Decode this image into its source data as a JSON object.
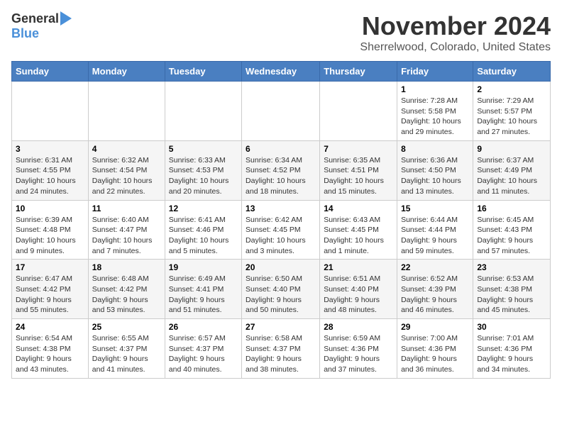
{
  "logo": {
    "general": "General",
    "blue": "Blue"
  },
  "title": "November 2024",
  "location": "Sherrelwood, Colorado, United States",
  "days_of_week": [
    "Sunday",
    "Monday",
    "Tuesday",
    "Wednesday",
    "Thursday",
    "Friday",
    "Saturday"
  ],
  "weeks": [
    [
      {
        "day": "",
        "info": ""
      },
      {
        "day": "",
        "info": ""
      },
      {
        "day": "",
        "info": ""
      },
      {
        "day": "",
        "info": ""
      },
      {
        "day": "",
        "info": ""
      },
      {
        "day": "1",
        "info": "Sunrise: 7:28 AM\nSunset: 5:58 PM\nDaylight: 10 hours and 29 minutes."
      },
      {
        "day": "2",
        "info": "Sunrise: 7:29 AM\nSunset: 5:57 PM\nDaylight: 10 hours and 27 minutes."
      }
    ],
    [
      {
        "day": "3",
        "info": "Sunrise: 6:31 AM\nSunset: 4:55 PM\nDaylight: 10 hours and 24 minutes."
      },
      {
        "day": "4",
        "info": "Sunrise: 6:32 AM\nSunset: 4:54 PM\nDaylight: 10 hours and 22 minutes."
      },
      {
        "day": "5",
        "info": "Sunrise: 6:33 AM\nSunset: 4:53 PM\nDaylight: 10 hours and 20 minutes."
      },
      {
        "day": "6",
        "info": "Sunrise: 6:34 AM\nSunset: 4:52 PM\nDaylight: 10 hours and 18 minutes."
      },
      {
        "day": "7",
        "info": "Sunrise: 6:35 AM\nSunset: 4:51 PM\nDaylight: 10 hours and 15 minutes."
      },
      {
        "day": "8",
        "info": "Sunrise: 6:36 AM\nSunset: 4:50 PM\nDaylight: 10 hours and 13 minutes."
      },
      {
        "day": "9",
        "info": "Sunrise: 6:37 AM\nSunset: 4:49 PM\nDaylight: 10 hours and 11 minutes."
      }
    ],
    [
      {
        "day": "10",
        "info": "Sunrise: 6:39 AM\nSunset: 4:48 PM\nDaylight: 10 hours and 9 minutes."
      },
      {
        "day": "11",
        "info": "Sunrise: 6:40 AM\nSunset: 4:47 PM\nDaylight: 10 hours and 7 minutes."
      },
      {
        "day": "12",
        "info": "Sunrise: 6:41 AM\nSunset: 4:46 PM\nDaylight: 10 hours and 5 minutes."
      },
      {
        "day": "13",
        "info": "Sunrise: 6:42 AM\nSunset: 4:45 PM\nDaylight: 10 hours and 3 minutes."
      },
      {
        "day": "14",
        "info": "Sunrise: 6:43 AM\nSunset: 4:45 PM\nDaylight: 10 hours and 1 minute."
      },
      {
        "day": "15",
        "info": "Sunrise: 6:44 AM\nSunset: 4:44 PM\nDaylight: 9 hours and 59 minutes."
      },
      {
        "day": "16",
        "info": "Sunrise: 6:45 AM\nSunset: 4:43 PM\nDaylight: 9 hours and 57 minutes."
      }
    ],
    [
      {
        "day": "17",
        "info": "Sunrise: 6:47 AM\nSunset: 4:42 PM\nDaylight: 9 hours and 55 minutes."
      },
      {
        "day": "18",
        "info": "Sunrise: 6:48 AM\nSunset: 4:42 PM\nDaylight: 9 hours and 53 minutes."
      },
      {
        "day": "19",
        "info": "Sunrise: 6:49 AM\nSunset: 4:41 PM\nDaylight: 9 hours and 51 minutes."
      },
      {
        "day": "20",
        "info": "Sunrise: 6:50 AM\nSunset: 4:40 PM\nDaylight: 9 hours and 50 minutes."
      },
      {
        "day": "21",
        "info": "Sunrise: 6:51 AM\nSunset: 4:40 PM\nDaylight: 9 hours and 48 minutes."
      },
      {
        "day": "22",
        "info": "Sunrise: 6:52 AM\nSunset: 4:39 PM\nDaylight: 9 hours and 46 minutes."
      },
      {
        "day": "23",
        "info": "Sunrise: 6:53 AM\nSunset: 4:38 PM\nDaylight: 9 hours and 45 minutes."
      }
    ],
    [
      {
        "day": "24",
        "info": "Sunrise: 6:54 AM\nSunset: 4:38 PM\nDaylight: 9 hours and 43 minutes."
      },
      {
        "day": "25",
        "info": "Sunrise: 6:55 AM\nSunset: 4:37 PM\nDaylight: 9 hours and 41 minutes."
      },
      {
        "day": "26",
        "info": "Sunrise: 6:57 AM\nSunset: 4:37 PM\nDaylight: 9 hours and 40 minutes."
      },
      {
        "day": "27",
        "info": "Sunrise: 6:58 AM\nSunset: 4:37 PM\nDaylight: 9 hours and 38 minutes."
      },
      {
        "day": "28",
        "info": "Sunrise: 6:59 AM\nSunset: 4:36 PM\nDaylight: 9 hours and 37 minutes."
      },
      {
        "day": "29",
        "info": "Sunrise: 7:00 AM\nSunset: 4:36 PM\nDaylight: 9 hours and 36 minutes."
      },
      {
        "day": "30",
        "info": "Sunrise: 7:01 AM\nSunset: 4:36 PM\nDaylight: 9 hours and 34 minutes."
      }
    ]
  ]
}
